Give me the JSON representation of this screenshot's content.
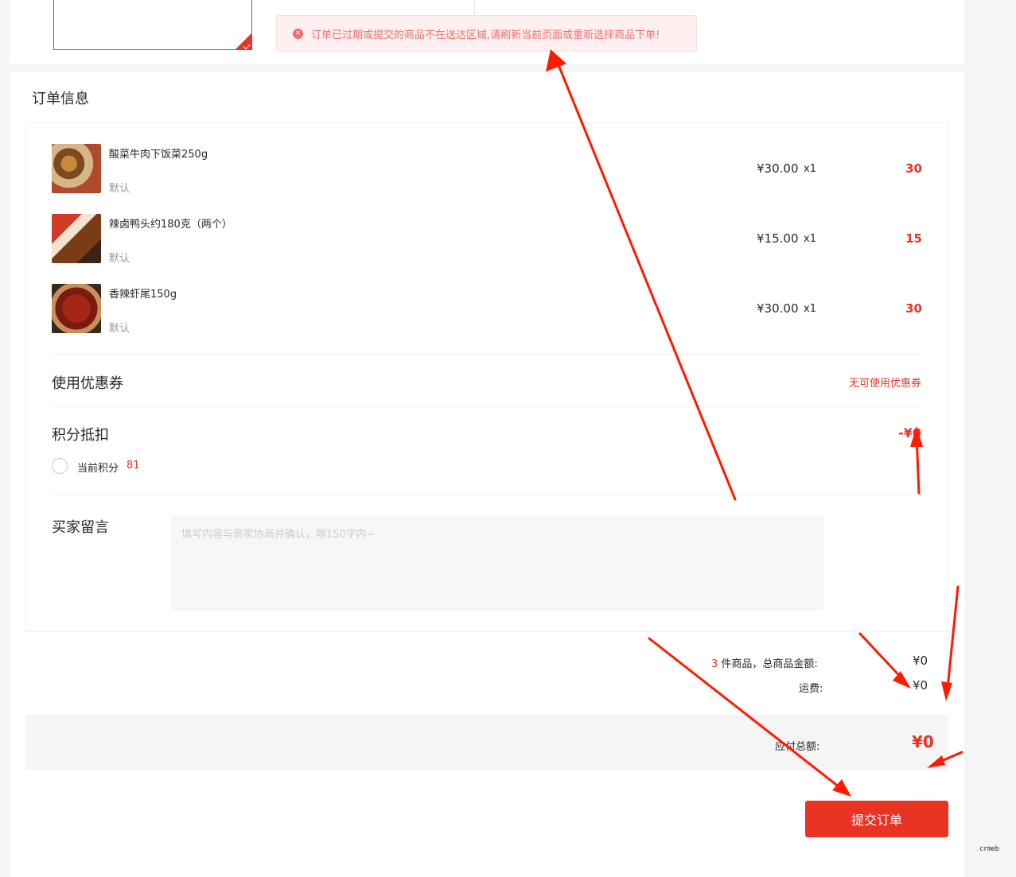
{
  "error_message": "订单已过期或提交的商品不在送达区域,请刷新当前页面或重新选择商品下单!",
  "section_title": "订单信息",
  "goods": [
    {
      "name": "酸菜牛肉下饭菜250g",
      "spec": "默认",
      "price": "¥30.00",
      "qty": "x1",
      "subtotal": "30"
    },
    {
      "name": "辣卤鸭头约180克（两个）",
      "spec": "默认",
      "price": "¥15.00",
      "qty": "x1",
      "subtotal": "15"
    },
    {
      "name": "香辣虾尾150g",
      "spec": "默认",
      "price": "¥30.00",
      "qty": "x1",
      "subtotal": "30"
    }
  ],
  "coupon": {
    "label": "使用优惠券",
    "value": "无可使用优惠券"
  },
  "points": {
    "label": "积分抵扣",
    "value": "-¥0",
    "current_label": "当前积分",
    "current_value": "81"
  },
  "message": {
    "label": "买家留言",
    "placeholder": "填写内容与商家协商并确认，限150字内~"
  },
  "summary": {
    "count": "3",
    "count_suffix": " 件商品，总商品金额:",
    "goods_amount": "¥0",
    "shipping_label": "运费:",
    "shipping_amount": "¥0"
  },
  "total": {
    "label": "应付总额:",
    "amount": "¥0"
  },
  "submit_label": "提交订单",
  "watermark": "crmeb",
  "colors": {
    "accent": "#e93323",
    "error": "#f56c6c",
    "annotation": "#ff1a00"
  }
}
